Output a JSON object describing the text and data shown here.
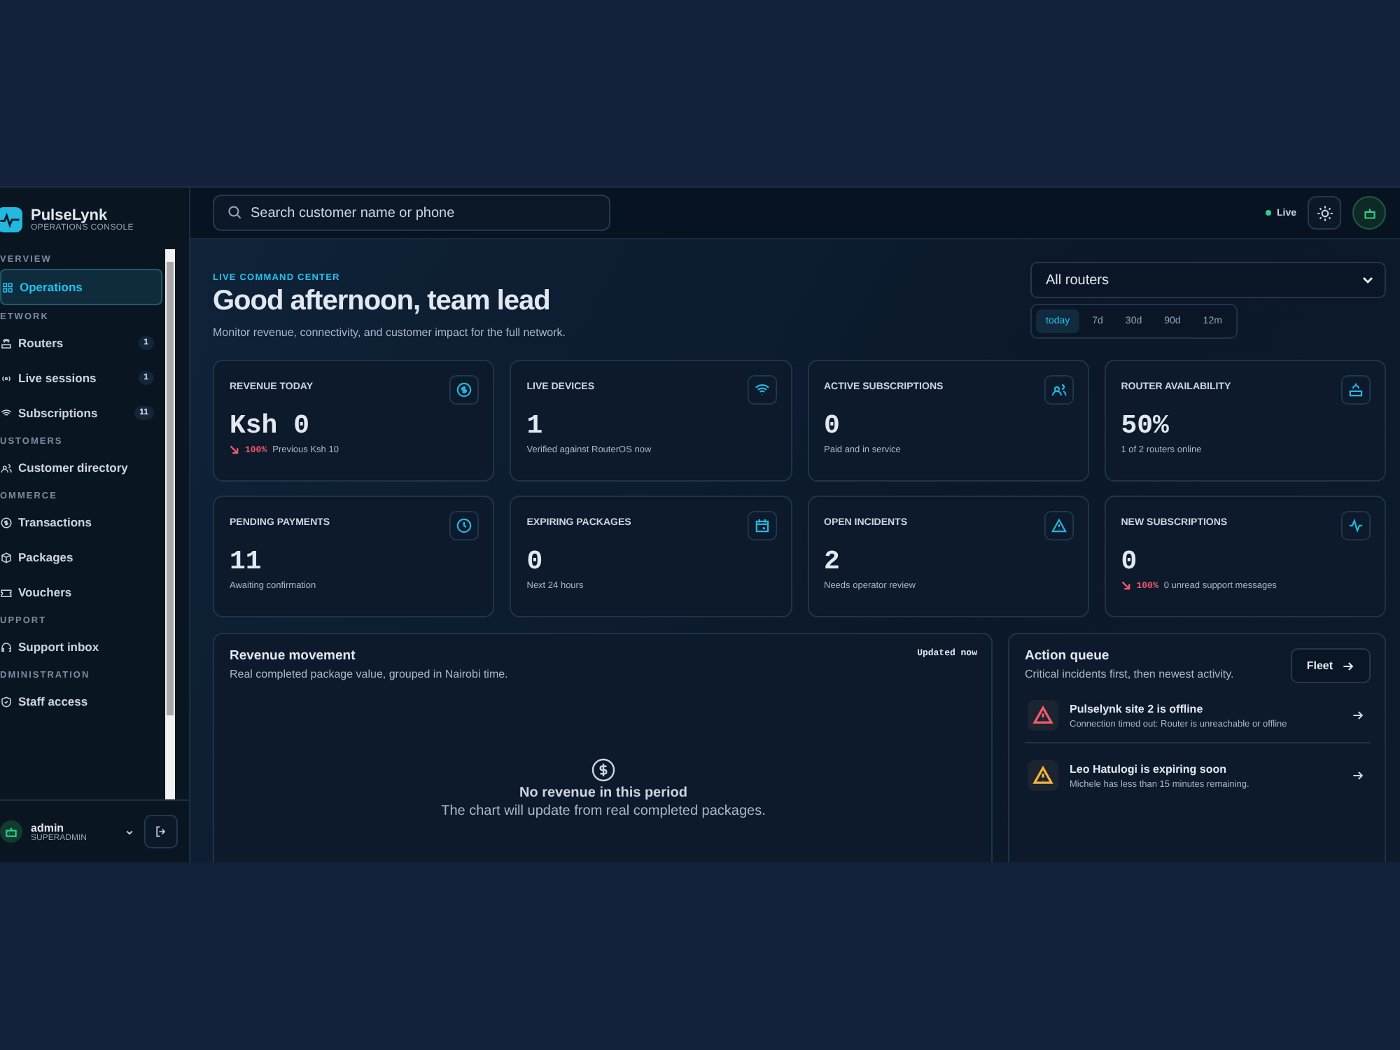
{
  "brand": {
    "name": "PulseLynk",
    "subtitle": "OPERATIONS CONSOLE"
  },
  "sidebar": {
    "sections": [
      {
        "label": "VERVIEW",
        "items": [
          {
            "label": "Operations",
            "selected": true
          }
        ]
      },
      {
        "label": "ETWORK",
        "items": [
          {
            "label": "Routers",
            "selected": false,
            "badge": "1"
          },
          {
            "label": "Live sessions",
            "selected": false,
            "badge": "1"
          },
          {
            "label": "Subscriptions",
            "selected": false,
            "badge": "11"
          }
        ]
      },
      {
        "label": "USTOMERS",
        "items": [
          {
            "label": "Customer directory",
            "selected": false
          }
        ]
      },
      {
        "label": "OMMERCE",
        "items": [
          {
            "label": "Transactions",
            "selected": false
          },
          {
            "label": "Packages",
            "selected": false
          },
          {
            "label": "Vouchers",
            "selected": false
          }
        ]
      },
      {
        "label": "UPPORT",
        "items": [
          {
            "label": "Support inbox",
            "selected": false
          }
        ]
      },
      {
        "label": "DMINISTRATION",
        "items": [
          {
            "label": "Staff access",
            "selected": false
          }
        ]
      }
    ],
    "user": {
      "name": "admin",
      "role": "SUPERADMIN"
    }
  },
  "search": {
    "placeholder": "Search customer name or phone"
  },
  "status": {
    "label": "Live"
  },
  "hero": {
    "eyebrow": "LIVE COMMAND CENTER",
    "title": "Good afternoon, team lead",
    "subtitle": "Monitor revenue, connectivity, and customer impact for the full network."
  },
  "router_select": {
    "value": "All routers"
  },
  "ranges": [
    {
      "label": "today",
      "selected": true
    },
    {
      "label": "7d",
      "selected": false
    },
    {
      "label": "30d",
      "selected": false
    },
    {
      "label": "90d",
      "selected": false
    },
    {
      "label": "12m",
      "selected": false
    }
  ],
  "metrics": [
    {
      "title": "REVENUE TODAY",
      "value": "Ksh 0",
      "delta": "100%",
      "note": "Previous Ksh 10"
    },
    {
      "title": "LIVE DEVICES",
      "value": "1",
      "note": "Verified against RouterOS now"
    },
    {
      "title": "ACTIVE SUBSCRIPTIONS",
      "value": "0",
      "note": "Paid and in service"
    },
    {
      "title": "ROUTER AVAILABILITY",
      "value": "50%",
      "note": "1 of 2 routers online"
    },
    {
      "title": "PENDING PAYMENTS",
      "value": "11",
      "note": "Awaiting confirmation"
    },
    {
      "title": "EXPIRING PACKAGES",
      "value": "0",
      "note": "Next 24 hours"
    },
    {
      "title": "OPEN INCIDENTS",
      "value": "2",
      "note": "Needs operator review"
    },
    {
      "title": "NEW SUBSCRIPTIONS",
      "value": "0",
      "delta": "100%",
      "note": "0 unread support messages"
    }
  ],
  "revenue": {
    "title": "Revenue movement",
    "subtitle": "Real completed package value, grouped in Nairobi time.",
    "badge": "Updated now",
    "empty_title": "No revenue in this period",
    "empty_text": "The chart will update from real completed packages."
  },
  "queue": {
    "title": "Action queue",
    "subtitle": "Critical incidents first, then newest activity.",
    "button": "Fleet",
    "items": [
      {
        "color": "#f05a6a",
        "title": "Pulselynk site 2 is offline",
        "text": "Connection timed out: Router is unreachable or offline"
      },
      {
        "color": "#f2b33d",
        "title": "Leo Hatulogi is expiring soon",
        "text": "Michele has less than 15 minutes remaining."
      }
    ]
  }
}
